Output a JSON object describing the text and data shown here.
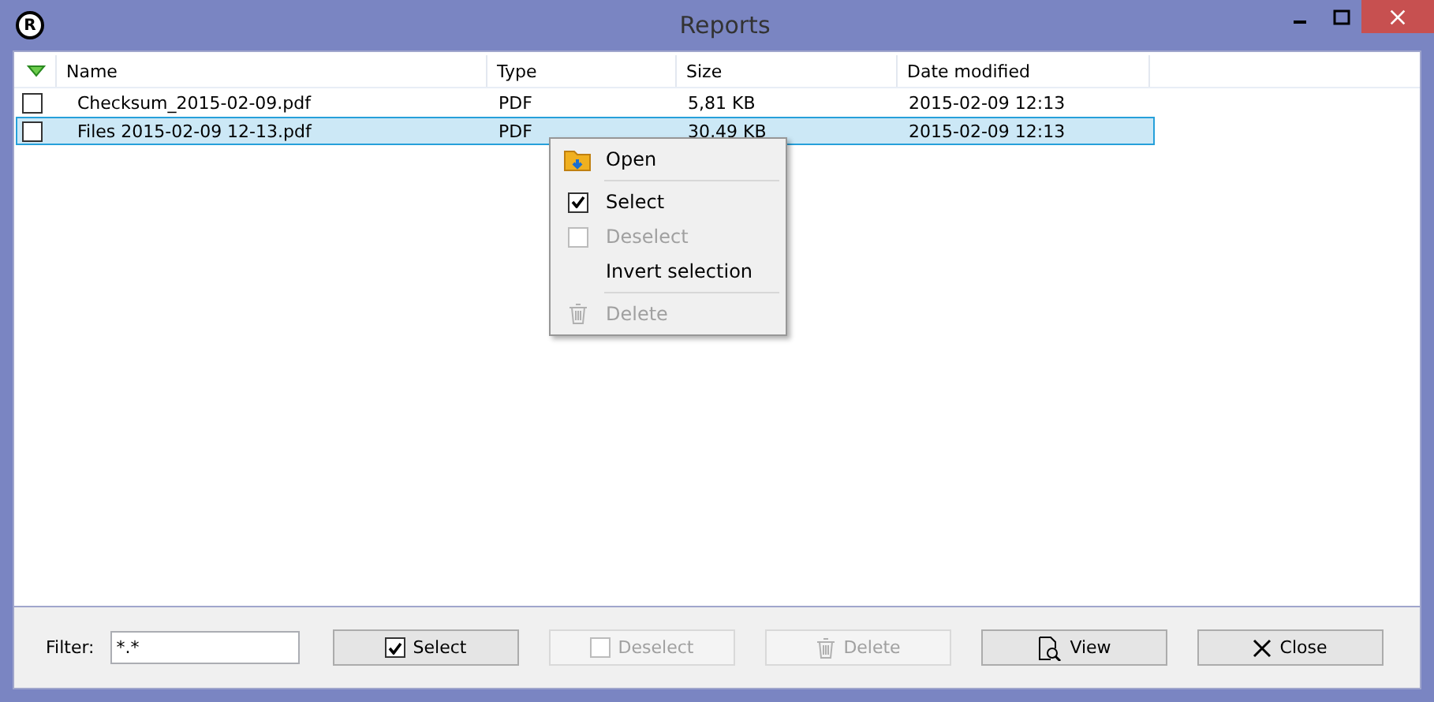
{
  "window": {
    "title": "Reports",
    "app_icon_letter": "R"
  },
  "table": {
    "columns": [
      "Name",
      "Type",
      "Size",
      "Date modified"
    ],
    "rows": [
      {
        "checked": false,
        "selected": false,
        "cells": [
          "Checksum_2015-02-09.pdf",
          "PDF",
          "5,81 KB",
          "2015-02-09 12:13"
        ]
      },
      {
        "checked": false,
        "selected": true,
        "cells": [
          "Files 2015-02-09 12-13.pdf",
          "PDF",
          "30,49 KB",
          "2015-02-09 12:13"
        ]
      }
    ]
  },
  "context_menu": {
    "items": [
      {
        "kind": "folder",
        "label": "Open",
        "disabled": false
      },
      {
        "kind": "separator"
      },
      {
        "kind": "checkbox",
        "checked": true,
        "label": "Select",
        "disabled": false
      },
      {
        "kind": "checkbox",
        "checked": false,
        "label": "Deselect",
        "disabled": true
      },
      {
        "kind": "plain",
        "label": "Invert selection",
        "disabled": false
      },
      {
        "kind": "separator"
      },
      {
        "kind": "trash",
        "label": "Delete",
        "disabled": true
      }
    ]
  },
  "filter": {
    "label": "Filter:",
    "value": "*.*"
  },
  "buttons": [
    {
      "kind": "checkbox",
      "checked": true,
      "label": "Select",
      "disabled": false
    },
    {
      "kind": "checkbox",
      "checked": false,
      "label": "Deselect",
      "disabled": true
    },
    {
      "kind": "trash",
      "label": "Delete",
      "disabled": true
    },
    {
      "kind": "view",
      "label": "View",
      "disabled": false
    },
    {
      "kind": "close",
      "label": "Close",
      "disabled": false
    }
  ]
}
